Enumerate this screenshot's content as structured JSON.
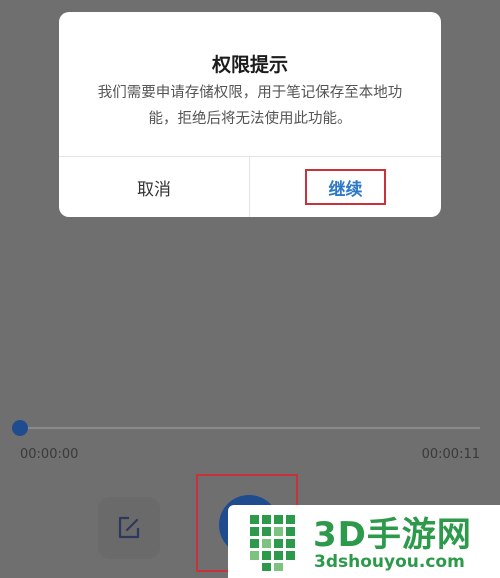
{
  "dialog": {
    "title": "权限提示",
    "message": "我们需要申请存储权限，用于笔记保存至本地功能，拒绝后将无法使用此功能。",
    "cancel_label": "取消",
    "continue_label": "继续"
  },
  "player": {
    "elapsed": "00:00:00",
    "total": "00:00:11",
    "progress": 0.0
  },
  "controls": {
    "edit_icon": "edit-icon",
    "record_icon": "record-icon"
  },
  "watermark": {
    "title": "3D手游网",
    "url": "3dshouyou.com"
  },
  "colors": {
    "accent": "#2d79c7",
    "record": "#1f4c8f",
    "highlight_box": "#c8323a",
    "watermark": "#2c9a4a",
    "overlay": "#6f6f6f"
  }
}
